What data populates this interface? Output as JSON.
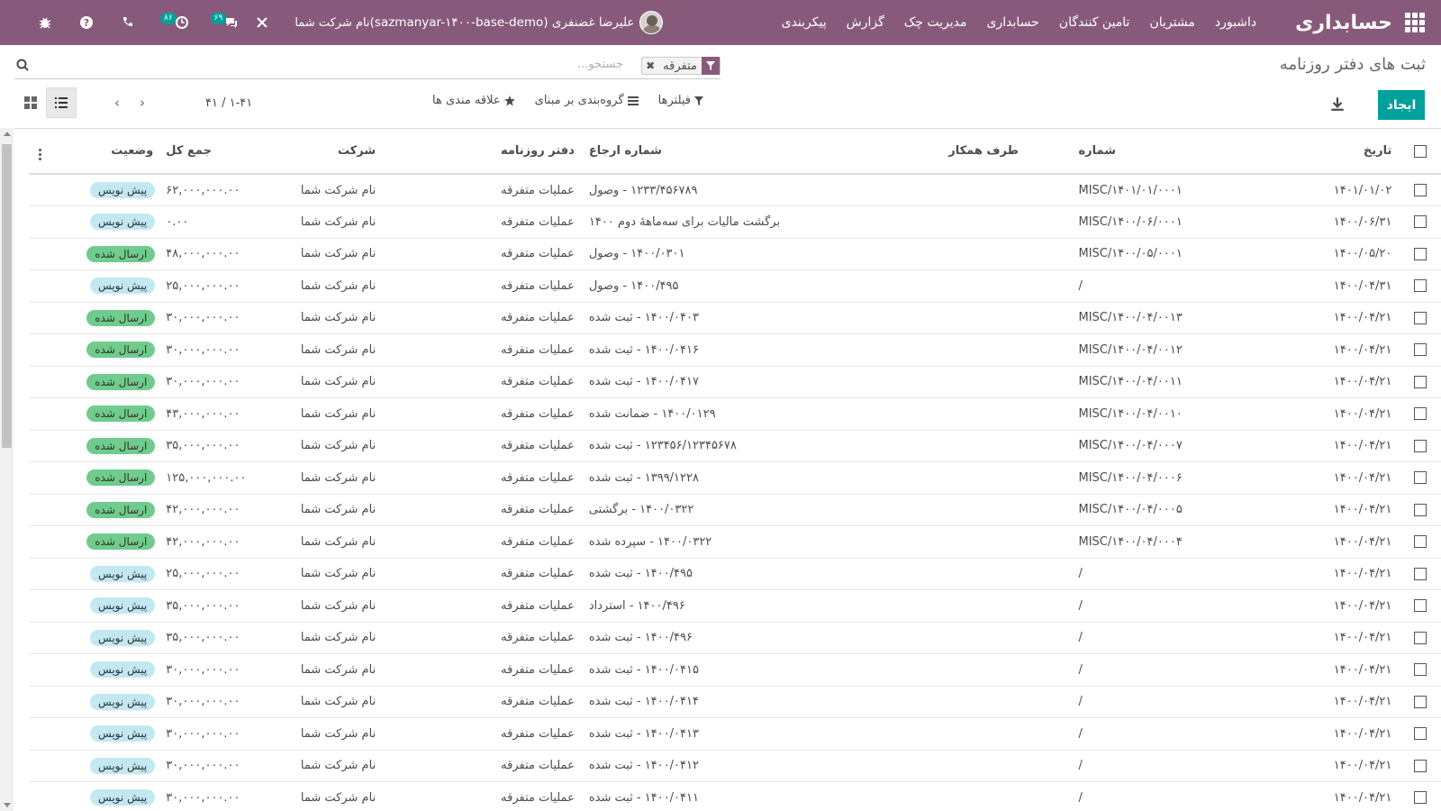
{
  "navbar": {
    "app_title": "حسابداری",
    "menu": [
      "داشبورد",
      "مشتریان",
      "تامین کنندگان",
      "حسابداری",
      "مدیریت چک",
      "گزارش",
      "پیکربندی"
    ],
    "user": "علیرضا غضنفری (sazmanyar-۱۴۰۰-base-demo)",
    "company": "نام شرکت شما",
    "activity_count": "۸۶",
    "messages_count": "۶۹"
  },
  "control": {
    "breadcrumb": "ثبت های دفتر روزنامه",
    "create_label": "ایجاد",
    "search_facet": "متفرقه",
    "search_placeholder": "جستجو...",
    "filters_label": "فیلترها",
    "groupby_label": "گروه‌بندی بر مبنای",
    "favorites_label": "علاقه مندی ها",
    "pager": "۱-۴۱ / ۴۱"
  },
  "table": {
    "columns": [
      "تاریخ",
      "شماره",
      "طرف همکار",
      "شماره ارجاع",
      "دفتر روزنامه",
      "شرکت",
      "جمع کل",
      "وضعیت"
    ],
    "rows": [
      {
        "date": "۱۴۰۱/۰۱/۰۲",
        "number": "MISC/۱۴۰۱/۰۱/۰۰۰۱",
        "partner": "",
        "ref": "۱۲۳۳/۴۵۶۷۸۹ - وصول",
        "journal": "عملیات متفرقه",
        "company": "نام شرکت شما",
        "total": "۶۲,۰۰۰,۰۰۰.۰۰",
        "status": "پیش نویس"
      },
      {
        "date": "۱۴۰۰/۰۶/۳۱",
        "number": "MISC/۱۴۰۰/۰۶/۰۰۰۱",
        "partner": "",
        "ref": "برگشت مالیات برای سه‌ماههٔ دوم ۱۴۰۰",
        "journal": "عملیات متفرقه",
        "company": "نام شرکت شما",
        "total": "۰.۰۰",
        "status": "پیش نویس"
      },
      {
        "date": "۱۴۰۰/۰۵/۲۰",
        "number": "MISC/۱۴۰۰/۰۵/۰۰۰۱",
        "partner": "",
        "ref": "۱۴۰۰/۰۳۰۱ - وصول",
        "journal": "عملیات متفرقه",
        "company": "نام شرکت شما",
        "total": "۴۸,۰۰۰,۰۰۰.۰۰",
        "status": "ارسال شده"
      },
      {
        "date": "۱۴۰۰/۰۴/۳۱",
        "number": "/",
        "partner": "",
        "ref": "۱۴۰۰/۴۹۵ - وصول",
        "journal": "عملیات متفرقه",
        "company": "نام شرکت شما",
        "total": "۲۵,۰۰۰,۰۰۰.۰۰",
        "status": "پیش نویس"
      },
      {
        "date": "۱۴۰۰/۰۴/۲۱",
        "number": "MISC/۱۴۰۰/۰۴/۰۰۱۳",
        "partner": "",
        "ref": "۱۴۰۰/۰۴۰۳ - ثبت شده",
        "journal": "عملیات متفرقه",
        "company": "نام شرکت شما",
        "total": "۳۰,۰۰۰,۰۰۰.۰۰",
        "status": "ارسال شده"
      },
      {
        "date": "۱۴۰۰/۰۴/۲۱",
        "number": "MISC/۱۴۰۰/۰۴/۰۰۱۲",
        "partner": "",
        "ref": "۱۴۰۰/۰۴۱۶ - ثبت شده",
        "journal": "عملیات متفرقه",
        "company": "نام شرکت شما",
        "total": "۳۰,۰۰۰,۰۰۰.۰۰",
        "status": "ارسال شده"
      },
      {
        "date": "۱۴۰۰/۰۴/۲۱",
        "number": "MISC/۱۴۰۰/۰۴/۰۰۱۱",
        "partner": "",
        "ref": "۱۴۰۰/۰۴۱۷ - ثبت شده",
        "journal": "عملیات متفرقه",
        "company": "نام شرکت شما",
        "total": "۳۰,۰۰۰,۰۰۰.۰۰",
        "status": "ارسال شده"
      },
      {
        "date": "۱۴۰۰/۰۴/۲۱",
        "number": "MISC/۱۴۰۰/۰۴/۰۰۱۰",
        "partner": "",
        "ref": "۱۴۰۰/۰۱۲۹ - ضمانت شده",
        "journal": "عملیات متفرقه",
        "company": "نام شرکت شما",
        "total": "۴۳,۰۰۰,۰۰۰.۰۰",
        "status": "ارسال شده"
      },
      {
        "date": "۱۴۰۰/۰۴/۲۱",
        "number": "MISC/۱۴۰۰/۰۴/۰۰۰۷",
        "partner": "",
        "ref": "۱۲۳۴۵۶/۱۲۳۴۵۶۷۸ - ثبت شده",
        "journal": "عملیات متفرقه",
        "company": "نام شرکت شما",
        "total": "۳۵,۰۰۰,۰۰۰.۰۰",
        "status": "ارسال شده"
      },
      {
        "date": "۱۴۰۰/۰۴/۲۱",
        "number": "MISC/۱۴۰۰/۰۴/۰۰۰۶",
        "partner": "",
        "ref": "۱۳۹۹/۱۲۲۸ - ثبت شده",
        "journal": "عملیات متفرقه",
        "company": "نام شرکت شما",
        "total": "۱۲۵,۰۰۰,۰۰۰.۰۰",
        "status": "ارسال شده"
      },
      {
        "date": "۱۴۰۰/۰۴/۲۱",
        "number": "MISC/۱۴۰۰/۰۴/۰۰۰۵",
        "partner": "",
        "ref": "۱۴۰۰/۰۳۲۲ - برگشتی",
        "journal": "عملیات متفرقه",
        "company": "نام شرکت شما",
        "total": "۴۲,۰۰۰,۰۰۰.۰۰",
        "status": "ارسال شده"
      },
      {
        "date": "۱۴۰۰/۰۴/۲۱",
        "number": "MISC/۱۴۰۰/۰۴/۰۰۰۴",
        "partner": "",
        "ref": "۱۴۰۰/۰۳۲۲ - سپرده شده",
        "journal": "عملیات متفرقه",
        "company": "نام شرکت شما",
        "total": "۴۲,۰۰۰,۰۰۰.۰۰",
        "status": "ارسال شده"
      },
      {
        "date": "۱۴۰۰/۰۴/۲۱",
        "number": "/",
        "partner": "",
        "ref": "۱۴۰۰/۴۹۵ - ثبت شده",
        "journal": "عملیات متفرقه",
        "company": "نام شرکت شما",
        "total": "۲۵,۰۰۰,۰۰۰.۰۰",
        "status": "پیش نویس"
      },
      {
        "date": "۱۴۰۰/۰۴/۲۱",
        "number": "/",
        "partner": "",
        "ref": "۱۴۰۰/۴۹۶ - استرداد",
        "journal": "عملیات متفرقه",
        "company": "نام شرکت شما",
        "total": "۳۵,۰۰۰,۰۰۰.۰۰",
        "status": "پیش نویس"
      },
      {
        "date": "۱۴۰۰/۰۴/۲۱",
        "number": "/",
        "partner": "",
        "ref": "۱۴۰۰/۴۹۶ - ثبت شده",
        "journal": "عملیات متفرقه",
        "company": "نام شرکت شما",
        "total": "۳۵,۰۰۰,۰۰۰.۰۰",
        "status": "پیش نویس"
      },
      {
        "date": "۱۴۰۰/۰۴/۲۱",
        "number": "/",
        "partner": "",
        "ref": "۱۴۰۰/۰۴۱۵ - ثبت شده",
        "journal": "عملیات متفرقه",
        "company": "نام شرکت شما",
        "total": "۳۰,۰۰۰,۰۰۰.۰۰",
        "status": "پیش نویس"
      },
      {
        "date": "۱۴۰۰/۰۴/۲۱",
        "number": "/",
        "partner": "",
        "ref": "۱۴۰۰/۰۴۱۴ - ثبت شده",
        "journal": "عملیات متفرقه",
        "company": "نام شرکت شما",
        "total": "۳۰,۰۰۰,۰۰۰.۰۰",
        "status": "پیش نویس"
      },
      {
        "date": "۱۴۰۰/۰۴/۲۱",
        "number": "/",
        "partner": "",
        "ref": "۱۴۰۰/۰۴۱۳ - ثبت شده",
        "journal": "عملیات متفرقه",
        "company": "نام شرکت شما",
        "total": "۳۰,۰۰۰,۰۰۰.۰۰",
        "status": "پیش نویس"
      },
      {
        "date": "۱۴۰۰/۰۴/۲۱",
        "number": "/",
        "partner": "",
        "ref": "۱۴۰۰/۰۴۱۲ - ثبت شده",
        "journal": "عملیات متفرقه",
        "company": "نام شرکت شما",
        "total": "۳۰,۰۰۰,۰۰۰.۰۰",
        "status": "پیش نویس"
      },
      {
        "date": "۱۴۰۰/۰۴/۲۱",
        "number": "/",
        "partner": "",
        "ref": "۱۴۰۰/۰۴۱۱ - ثبت شده",
        "journal": "عملیات متفرقه",
        "company": "نام شرکت شما",
        "total": "۳۰,۰۰۰,۰۰۰.۰۰",
        "status": "پیش نویس"
      }
    ]
  },
  "colors": {
    "navbar": "#875a7b",
    "primary_button": "#00a09d",
    "status_draft": "#c2e8f2",
    "status_posted": "#6fcc8c"
  }
}
